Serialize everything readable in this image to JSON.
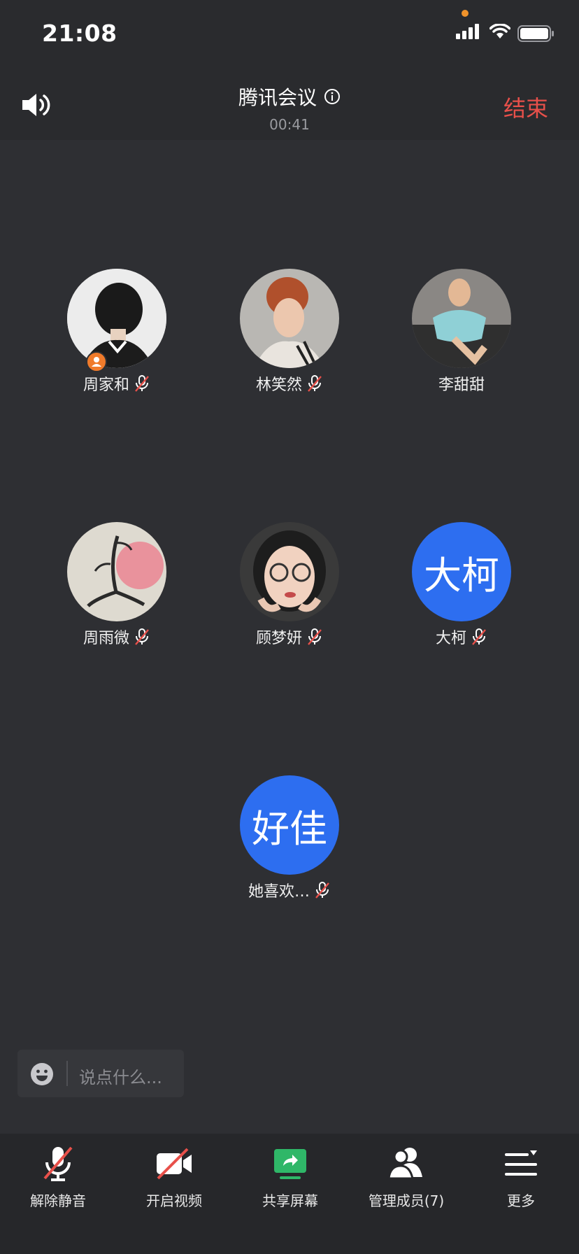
{
  "status_bar": {
    "time": "21:08"
  },
  "header": {
    "title": "腾讯会议",
    "timer": "00:41",
    "end_label": "结束"
  },
  "participants": [
    {
      "name": "周家和",
      "avatar": "photo",
      "muted": true,
      "host": true
    },
    {
      "name": "林笑然",
      "avatar": "photo",
      "muted": true,
      "host": false
    },
    {
      "name": "李甜甜",
      "avatar": "photo",
      "muted": false,
      "host": false
    },
    {
      "name": "周雨微",
      "avatar": "photo",
      "muted": true,
      "host": false
    },
    {
      "name": "顾梦妍",
      "avatar": "photo",
      "muted": true,
      "host": false
    },
    {
      "name": "大柯",
      "avatar_text": "大柯",
      "muted": true,
      "host": false
    },
    {
      "name": "她喜欢…",
      "avatar_text": "好佳",
      "muted": true,
      "host": false
    }
  ],
  "chat": {
    "placeholder": "说点什么..."
  },
  "toolbar": {
    "unmute": "解除静音",
    "video": "开启视频",
    "share": "共享屏幕",
    "members": "管理成员(7)",
    "more": "更多"
  },
  "colors": {
    "end": "#e8504a",
    "avatar_blue": "#2d6ef0",
    "host_badge": "#f07b2b",
    "share_green": "#2fb768",
    "mute_red": "#e8504a"
  }
}
